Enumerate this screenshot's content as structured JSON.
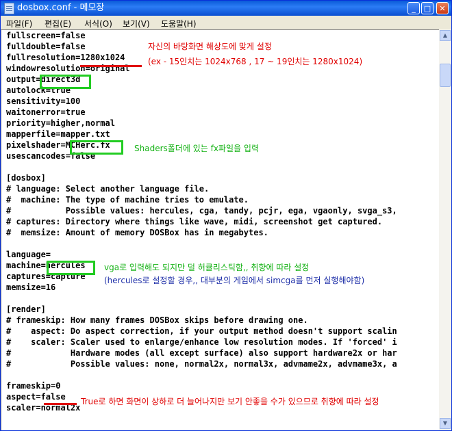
{
  "window": {
    "title": "dosbox.conf - 메모장",
    "controls": [
      "_",
      "□",
      "✕"
    ]
  },
  "menu": {
    "items": [
      "파일(F)",
      "편집(E)",
      "서식(O)",
      "보기(V)",
      "도움말(H)"
    ]
  },
  "lines": [
    "fullscreen=false",
    "fulldouble=false",
    "fullresolution=1280x1024",
    "windowresolution=original",
    "output=direct3d",
    "autolock=true",
    "sensitivity=100",
    "waitonerror=true",
    "priority=higher,normal",
    "mapperfile=mapper.txt",
    "pixelshader=MCHerc.fx",
    "usescancodes=false",
    "",
    "[dosbox]",
    "# language: Select another language file.",
    "#  machine: The type of machine tries to emulate.",
    "#           Possible values: hercules, cga, tandy, pcjr, ega, vgaonly, svga_s3,",
    "# captures: Directory where things like wave, midi, screenshot get captured.",
    "#  memsize: Amount of memory DOSBox has in megabytes.",
    "",
    "language=",
    "machine=hercules",
    "captures=capture",
    "memsize=16",
    "",
    "[render]",
    "# frameskip: How many frames DOSBox skips before drawing one.",
    "#    aspect: Do aspect correction, if your output method doesn't support scalin",
    "#    scaler: Scaler used to enlarge/enhance low resolution modes. If 'forced' i",
    "#            Hardware modes (all except surface) also support hardware2x or har",
    "#            Possible values: none, normal2x, normal3x, advmame2x, advmame3x, a",
    "",
    "frameskip=0",
    "aspect=false",
    "scaler=normal2x"
  ],
  "annotations": {
    "resolution_title": "자신의 바탕화면 해상도에 맞게 설정",
    "resolution_example": "(ex - 15인치는 1024x768 , 17 ~ 19인치는 1280x1024)",
    "shader": "Shaders폴더에 있는 fx파일을 입력",
    "machine": "vga로 입력해도 되지만 덜 허큘리스틱함,, 취향에 따라 설정",
    "machine_note": "(hercules로 설정할 경우,, 대부분의 게임에서 simcga를 먼저 실행해야함)",
    "aspect": "True로 하면 화면이 상하로 더 늘어나지만 보기 안좋을 수가 있으므로 취향에 따라 설정"
  },
  "colors": {
    "highlight_box": "#22cc22",
    "underline": "#e01010",
    "note_red": "#e00000",
    "note_green": "#14b214",
    "note_blue": "#1e2fa8"
  }
}
